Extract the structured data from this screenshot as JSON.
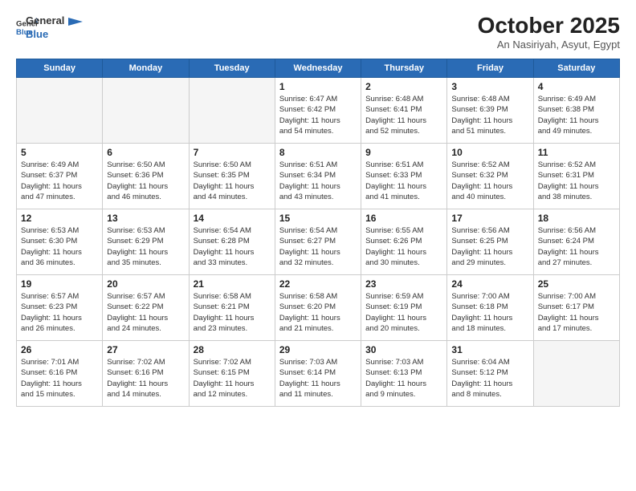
{
  "logo": {
    "line1": "General",
    "line2": "Blue"
  },
  "title": "October 2025",
  "subtitle": "An Nasiriyah, Asyut, Egypt",
  "header_days": [
    "Sunday",
    "Monday",
    "Tuesday",
    "Wednesday",
    "Thursday",
    "Friday",
    "Saturday"
  ],
  "weeks": [
    [
      {
        "day": "",
        "info": ""
      },
      {
        "day": "",
        "info": ""
      },
      {
        "day": "",
        "info": ""
      },
      {
        "day": "1",
        "info": "Sunrise: 6:47 AM\nSunset: 6:42 PM\nDaylight: 11 hours\nand 54 minutes."
      },
      {
        "day": "2",
        "info": "Sunrise: 6:48 AM\nSunset: 6:41 PM\nDaylight: 11 hours\nand 52 minutes."
      },
      {
        "day": "3",
        "info": "Sunrise: 6:48 AM\nSunset: 6:39 PM\nDaylight: 11 hours\nand 51 minutes."
      },
      {
        "day": "4",
        "info": "Sunrise: 6:49 AM\nSunset: 6:38 PM\nDaylight: 11 hours\nand 49 minutes."
      }
    ],
    [
      {
        "day": "5",
        "info": "Sunrise: 6:49 AM\nSunset: 6:37 PM\nDaylight: 11 hours\nand 47 minutes."
      },
      {
        "day": "6",
        "info": "Sunrise: 6:50 AM\nSunset: 6:36 PM\nDaylight: 11 hours\nand 46 minutes."
      },
      {
        "day": "7",
        "info": "Sunrise: 6:50 AM\nSunset: 6:35 PM\nDaylight: 11 hours\nand 44 minutes."
      },
      {
        "day": "8",
        "info": "Sunrise: 6:51 AM\nSunset: 6:34 PM\nDaylight: 11 hours\nand 43 minutes."
      },
      {
        "day": "9",
        "info": "Sunrise: 6:51 AM\nSunset: 6:33 PM\nDaylight: 11 hours\nand 41 minutes."
      },
      {
        "day": "10",
        "info": "Sunrise: 6:52 AM\nSunset: 6:32 PM\nDaylight: 11 hours\nand 40 minutes."
      },
      {
        "day": "11",
        "info": "Sunrise: 6:52 AM\nSunset: 6:31 PM\nDaylight: 11 hours\nand 38 minutes."
      }
    ],
    [
      {
        "day": "12",
        "info": "Sunrise: 6:53 AM\nSunset: 6:30 PM\nDaylight: 11 hours\nand 36 minutes."
      },
      {
        "day": "13",
        "info": "Sunrise: 6:53 AM\nSunset: 6:29 PM\nDaylight: 11 hours\nand 35 minutes."
      },
      {
        "day": "14",
        "info": "Sunrise: 6:54 AM\nSunset: 6:28 PM\nDaylight: 11 hours\nand 33 minutes."
      },
      {
        "day": "15",
        "info": "Sunrise: 6:54 AM\nSunset: 6:27 PM\nDaylight: 11 hours\nand 32 minutes."
      },
      {
        "day": "16",
        "info": "Sunrise: 6:55 AM\nSunset: 6:26 PM\nDaylight: 11 hours\nand 30 minutes."
      },
      {
        "day": "17",
        "info": "Sunrise: 6:56 AM\nSunset: 6:25 PM\nDaylight: 11 hours\nand 29 minutes."
      },
      {
        "day": "18",
        "info": "Sunrise: 6:56 AM\nSunset: 6:24 PM\nDaylight: 11 hours\nand 27 minutes."
      }
    ],
    [
      {
        "day": "19",
        "info": "Sunrise: 6:57 AM\nSunset: 6:23 PM\nDaylight: 11 hours\nand 26 minutes."
      },
      {
        "day": "20",
        "info": "Sunrise: 6:57 AM\nSunset: 6:22 PM\nDaylight: 11 hours\nand 24 minutes."
      },
      {
        "day": "21",
        "info": "Sunrise: 6:58 AM\nSunset: 6:21 PM\nDaylight: 11 hours\nand 23 minutes."
      },
      {
        "day": "22",
        "info": "Sunrise: 6:58 AM\nSunset: 6:20 PM\nDaylight: 11 hours\nand 21 minutes."
      },
      {
        "day": "23",
        "info": "Sunrise: 6:59 AM\nSunset: 6:19 PM\nDaylight: 11 hours\nand 20 minutes."
      },
      {
        "day": "24",
        "info": "Sunrise: 7:00 AM\nSunset: 6:18 PM\nDaylight: 11 hours\nand 18 minutes."
      },
      {
        "day": "25",
        "info": "Sunrise: 7:00 AM\nSunset: 6:17 PM\nDaylight: 11 hours\nand 17 minutes."
      }
    ],
    [
      {
        "day": "26",
        "info": "Sunrise: 7:01 AM\nSunset: 6:16 PM\nDaylight: 11 hours\nand 15 minutes."
      },
      {
        "day": "27",
        "info": "Sunrise: 7:02 AM\nSunset: 6:16 PM\nDaylight: 11 hours\nand 14 minutes."
      },
      {
        "day": "28",
        "info": "Sunrise: 7:02 AM\nSunset: 6:15 PM\nDaylight: 11 hours\nand 12 minutes."
      },
      {
        "day": "29",
        "info": "Sunrise: 7:03 AM\nSunset: 6:14 PM\nDaylight: 11 hours\nand 11 minutes."
      },
      {
        "day": "30",
        "info": "Sunrise: 7:03 AM\nSunset: 6:13 PM\nDaylight: 11 hours\nand 9 minutes."
      },
      {
        "day": "31",
        "info": "Sunrise: 6:04 AM\nSunset: 5:12 PM\nDaylight: 11 hours\nand 8 minutes."
      },
      {
        "day": "",
        "info": ""
      }
    ]
  ]
}
